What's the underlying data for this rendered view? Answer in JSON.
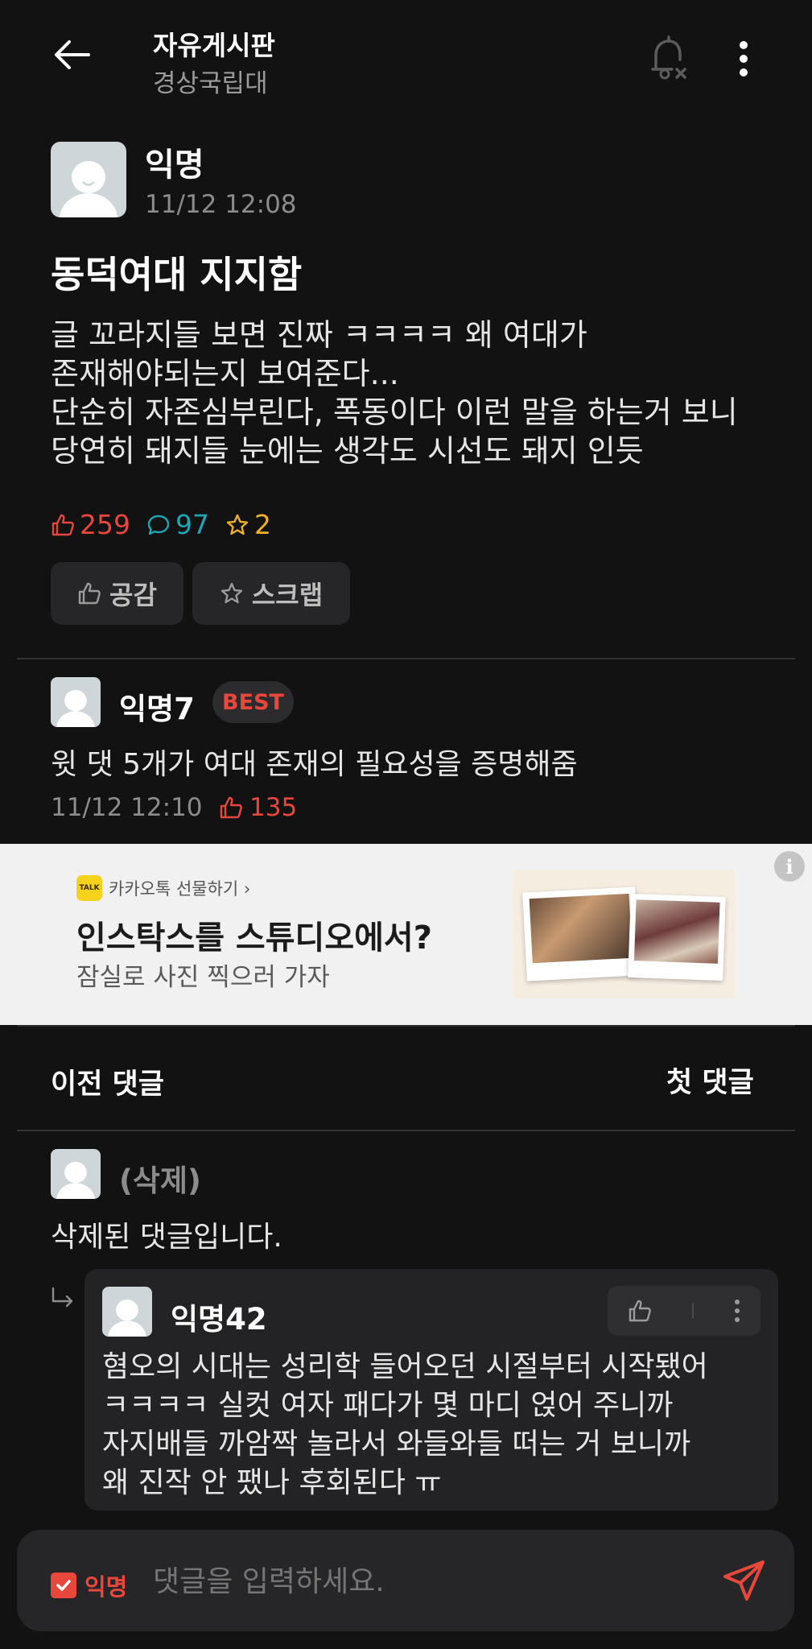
{
  "header": {
    "title": "자유게시판",
    "subtitle": "경상국립대"
  },
  "post": {
    "author": "익명",
    "time": "11/12 12:08",
    "title": "동덕여대 지지함",
    "body": "글 꼬라지들 보면 진짜 ㅋㅋㅋㅋ 왜 여대가\n존재해야되는지 보여준다...\n단순히 자존심부린다, 폭동이다 이런 말을 하는거 보니\n당연히 돼지들 눈에는 생각도 시선도 돼지 인듯",
    "likes": "259",
    "comments": "97",
    "scraps": "2",
    "like_button": "공감",
    "scrap_button": "스크랩"
  },
  "best_comment": {
    "author": "익명7",
    "badge": "BEST",
    "text": "윗 댓 5개가 여대 존재의 필요성을 증명해줌",
    "time": "11/12 12:10",
    "likes": "135"
  },
  "ad": {
    "brand": "카카오톡 선물하기 ›",
    "logo_text": "TALK",
    "headline": "인스탁스를 스튜디오에서?",
    "subline": "잠실로 사진 찍으러 가자",
    "info": "i"
  },
  "comment_nav": {
    "prev": "이전 댓글",
    "first": "첫 댓글"
  },
  "deleted_comment": {
    "author": "(삭제)",
    "text": "삭제된 댓글입니다."
  },
  "reply": {
    "author": "익명42",
    "text": "혐오의 시대는 성리학 들어오던 시절부터 시작됐어\nㅋㅋㅋㅋ 실컷 여자 패다가 몇 마디 얹어 주니까\n자지배들 까암짝 놀라서 와들와들 떠는 거 보니까\n왜 진작 안 팼나 후회된다 ㅠ"
  },
  "input": {
    "anon_label": "익명",
    "placeholder": "댓글을 입력하세요."
  },
  "colors": {
    "background": "#121213",
    "accent_red": "#e8473c",
    "comment_teal": "#1fa5b5",
    "scrap_yellow": "#f0b02b"
  },
  "icons": [
    "back-arrow-icon",
    "bell-off-icon",
    "more-vertical-icon",
    "thumbs-up-icon",
    "chat-bubble-icon",
    "star-icon",
    "reply-arrow-icon",
    "send-icon",
    "checkbox-icon",
    "info-icon"
  ]
}
